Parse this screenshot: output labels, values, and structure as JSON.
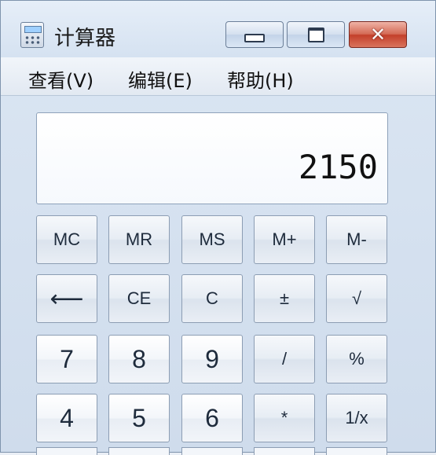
{
  "window": {
    "title": "计算器",
    "controls": {
      "minimize": "minimize-icon",
      "maximize": "maximize-icon",
      "close": "close-icon"
    }
  },
  "menu": [
    "查看(V)",
    "编辑(E)",
    "帮助(H)"
  ],
  "display": {
    "value": "2150"
  },
  "keys": {
    "row1": [
      "MC",
      "MR",
      "MS",
      "M+",
      "M-"
    ],
    "row2": [
      "⟵",
      "CE",
      "C",
      "±",
      "√"
    ],
    "row3": [
      "7",
      "8",
      "9",
      "/",
      "%"
    ],
    "row4": [
      "4",
      "5",
      "6",
      "*",
      "1/x"
    ]
  }
}
